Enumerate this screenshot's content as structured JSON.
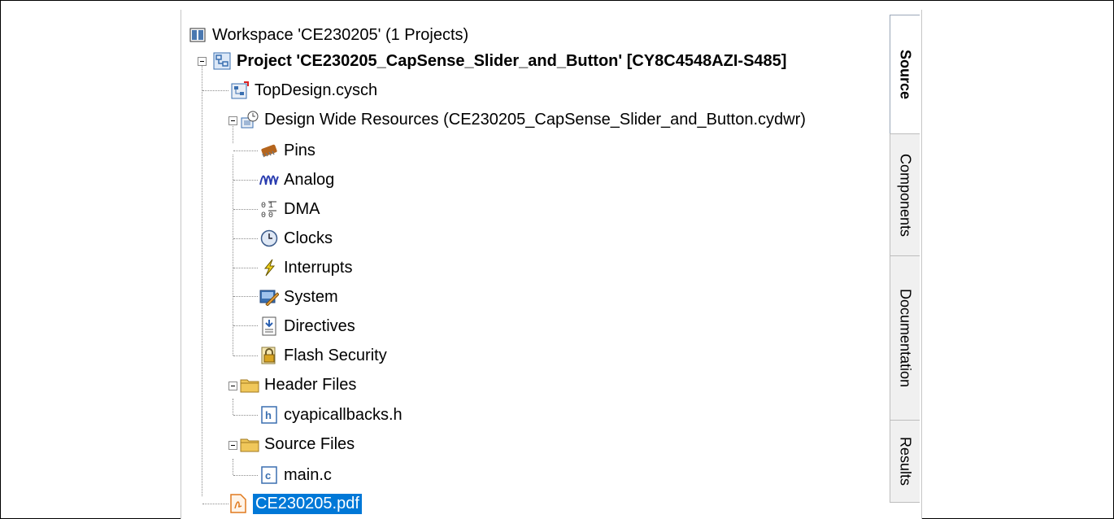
{
  "tree": {
    "workspace": "Workspace 'CE230205' (1 Projects)",
    "project": "Project 'CE230205_CapSense_Slider_and_Button' [CY8C4548AZI-S485]",
    "topdesign": "TopDesign.cysch",
    "dwr": "Design Wide Resources (CE230205_CapSense_Slider_and_Button.cydwr)",
    "dwr_items": [
      "Pins",
      "Analog",
      "DMA",
      "Clocks",
      "Interrupts",
      "System",
      "Directives",
      "Flash Security"
    ],
    "header_folder": "Header Files",
    "header_file": "cyapicallbacks.h",
    "source_folder": "Source Files",
    "source_file": "main.c",
    "pdf": "CE230205.pdf"
  },
  "tabs": [
    "Source",
    "Components",
    "Documentation",
    "Results"
  ],
  "active_tab": "Source",
  "icons": {
    "workspace": "workspace-icon",
    "project": "project-icon",
    "schematic": "schematic-icon",
    "dwr": "design-resources-icon",
    "pins": "pins-chip-icon",
    "analog": "analog-wave-icon",
    "dma": "dma-icon",
    "clocks": "clock-icon",
    "interrupts": "lightning-icon",
    "system": "system-icon",
    "directives": "directives-icon",
    "flash": "lock-icon",
    "folder": "folder-icon",
    "header": "h-file-icon",
    "cfile": "c-file-icon",
    "pdf": "pdf-icon"
  },
  "colors": {
    "selection": "#0078d7",
    "folder": "#f0c75a"
  }
}
